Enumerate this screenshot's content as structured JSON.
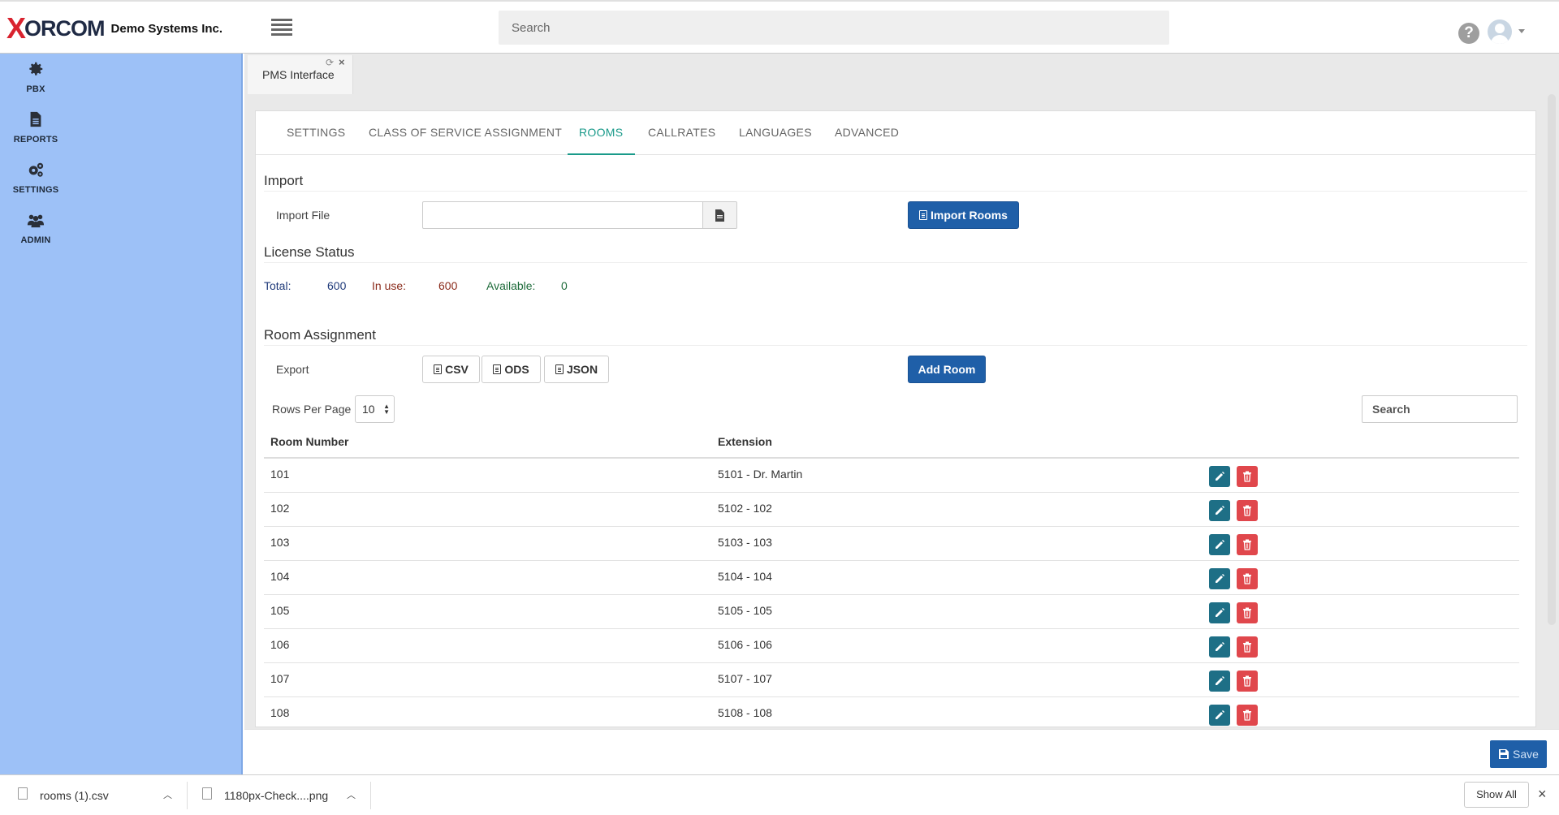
{
  "header": {
    "logo_x": "X",
    "logo_rest": "ORCOM",
    "company": "Demo Systems Inc.",
    "search_placeholder": "Search",
    "help_glyph": "?"
  },
  "sidebar": {
    "items": [
      {
        "label": "PBX",
        "icon": "gear-icon"
      },
      {
        "label": "REPORTS",
        "icon": "document-icon"
      },
      {
        "label": "SETTINGS",
        "icon": "gears-icon"
      },
      {
        "label": "ADMIN",
        "icon": "users-icon"
      }
    ]
  },
  "doc_tab": {
    "title": "PMS Interface",
    "refresh": "⟳",
    "close": "×"
  },
  "tabs": [
    {
      "label": "SETTINGS"
    },
    {
      "label": "CLASS OF SERVICE ASSIGNMENT"
    },
    {
      "label": "ROOMS",
      "active": true
    },
    {
      "label": "CALLRATES"
    },
    {
      "label": "LANGUAGES"
    },
    {
      "label": "ADVANCED"
    }
  ],
  "import": {
    "section_title": "Import",
    "file_label": "Import File",
    "import_button": "Import Rooms"
  },
  "license": {
    "section_title": "License Status",
    "total_label": "Total:",
    "total_value": "600",
    "in_use_label": "In use:",
    "in_use_value": "600",
    "available_label": "Available:",
    "available_value": "0",
    "colors": {
      "total": "#1f3a7a",
      "in_use": "#8a2a1a",
      "available": "#1d6b3a"
    }
  },
  "room_assignment": {
    "section_title": "Room Assignment",
    "export_label": "Export",
    "export_buttons": [
      "CSV",
      "ODS",
      "JSON"
    ],
    "add_button": "Add Room",
    "rows_per_page_label": "Rows Per Page",
    "rows_per_page_value": "10",
    "search_placeholder": "Search",
    "columns": [
      "Room Number",
      "Extension"
    ],
    "rows": [
      {
        "room": "101",
        "extension": "5101 - Dr. Martin"
      },
      {
        "room": "102",
        "extension": "5102 - 102"
      },
      {
        "room": "103",
        "extension": "5103 - 103"
      },
      {
        "room": "104",
        "extension": "5104 - 104"
      },
      {
        "room": "105",
        "extension": "5105 - 105"
      },
      {
        "room": "106",
        "extension": "5106 - 106"
      },
      {
        "room": "107",
        "extension": "5107 - 107"
      },
      {
        "room": "108",
        "extension": "5108 - 108"
      }
    ]
  },
  "footer": {
    "save_label": "Save"
  },
  "downloads": {
    "items": [
      {
        "name": "rooms (1).csv"
      },
      {
        "name": "1180px-Check....png"
      }
    ],
    "show_all": "Show All",
    "close": "×"
  },
  "colors": {
    "accent": "#1a9a8a",
    "primary": "#1f5fa8",
    "sidebar": "#9dc1f7",
    "danger": "#e0474c",
    "edit": "#1e6f86"
  }
}
